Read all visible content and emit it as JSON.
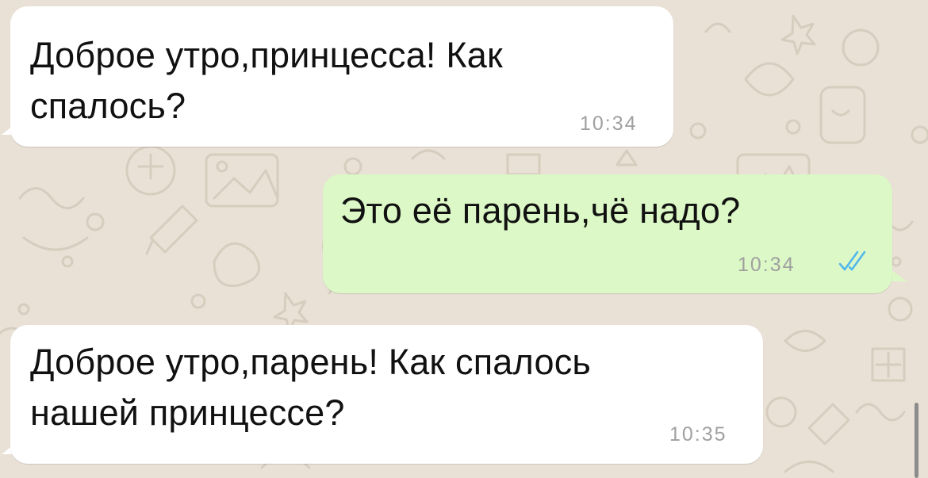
{
  "chat": {
    "messages": [
      {
        "direction": "incoming",
        "text": "Доброе утро,принцесса! Как\nспалось?",
        "time": "10:34"
      },
      {
        "direction": "outgoing",
        "text": "Это её парень,чё надо?",
        "time": "10:34",
        "status": "read"
      },
      {
        "direction": "incoming",
        "text": "Доброе утро,парень! Как спалось\nнашей принцессе?",
        "time": "10:35"
      }
    ]
  },
  "colors": {
    "background": "#e9e1d6",
    "incoming_bubble": "#ffffff",
    "outgoing_bubble": "#dcf8c6",
    "read_ticks": "#4fb6ec",
    "timestamp": "#a0a0a0"
  },
  "icons": [
    "read-receipt-double-check-icon",
    "chat-wallpaper-doodles"
  ]
}
